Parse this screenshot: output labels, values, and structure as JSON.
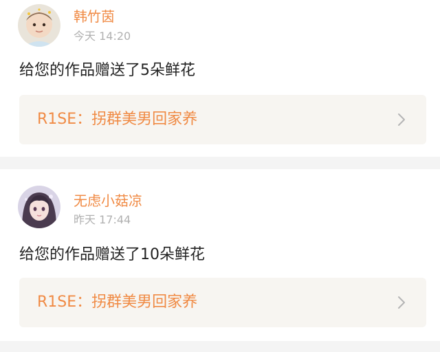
{
  "notifications": [
    {
      "username": "韩竹茵",
      "time": "今天 14:20",
      "message": "给您的作品赠送了5朵鲜花",
      "work_title": "R1SE：拐群美男回家养",
      "avatar": "child-photo-avatar"
    },
    {
      "username": "无虑小菇凉",
      "time": "昨天 17:44",
      "message": "给您的作品赠送了10朵鲜花",
      "work_title": "R1SE：拐群美男回家养",
      "avatar": "anime-girl-avatar"
    }
  ],
  "colors": {
    "accent": "#f08a44",
    "time": "#b0b0b0",
    "message": "#222222",
    "link_bg": "#f7f5f1",
    "divider": "#f4f4f4"
  },
  "icons": {
    "link_arrow": "chevron-right-icon"
  }
}
